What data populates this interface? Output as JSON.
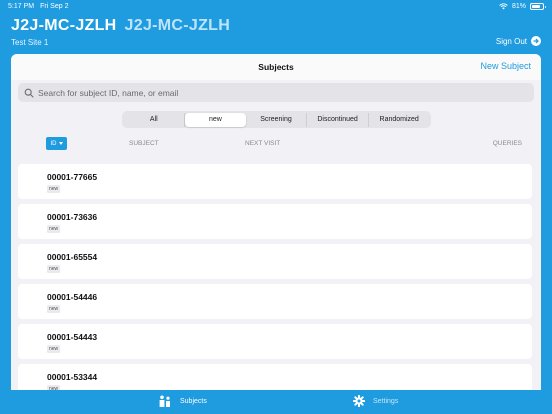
{
  "status_bar": {
    "time": "5:17 PM",
    "date": "Fri Sep 2",
    "battery": "81%",
    "battery_level": 0.81
  },
  "header": {
    "title": "J2J-MC-JZLH",
    "subtitle": "J2J-MC-JZLH",
    "site": "Test Site 1",
    "sign_out_label": "Sign Out"
  },
  "card": {
    "title": "Subjects",
    "new_subject_label": "New Subject"
  },
  "search": {
    "placeholder": "Search for subject ID, name, or email"
  },
  "filters": {
    "selected": "new",
    "items": [
      "All",
      "new",
      "Screening",
      "Discontinued",
      "Randomized"
    ]
  },
  "columns": {
    "sort_label": "ID",
    "subject": "SUBJECT",
    "next_visit": "NEXT VISIT",
    "queries": "QUERIES"
  },
  "subjects": [
    {
      "id": "00001-77665",
      "status": "new"
    },
    {
      "id": "00001-73636",
      "status": "new"
    },
    {
      "id": "00001-65554",
      "status": "new"
    },
    {
      "id": "00001-54446",
      "status": "new"
    },
    {
      "id": "00001-54443",
      "status": "new"
    },
    {
      "id": "00001-53344",
      "status": "new"
    }
  ],
  "tabs": [
    {
      "label": "Subjects",
      "active": true
    },
    {
      "label": "Settings",
      "active": false
    }
  ],
  "colors": {
    "accent": "#1f9be0",
    "background": "#f2f2f6",
    "subtitle": "#bfe4fa"
  }
}
